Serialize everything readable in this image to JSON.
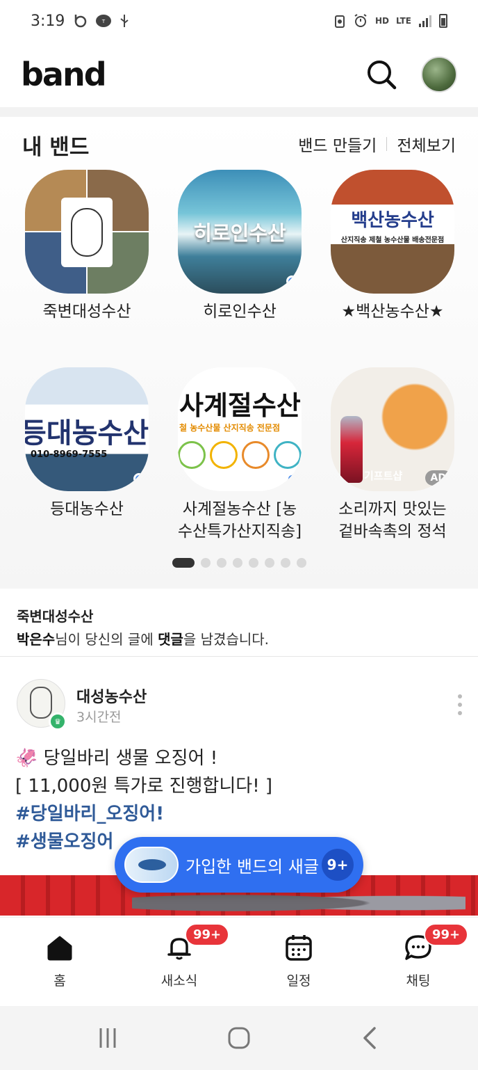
{
  "status_bar": {
    "time": "3:19",
    "left_icons": [
      "b-app-icon",
      "tmap-icon",
      "usb-icon"
    ],
    "right_icons": [
      "data-saver-icon",
      "alarm-icon",
      "hd-voice-icon",
      "lte-icon",
      "signal-icon",
      "battery-icon"
    ],
    "hd_label": "HD",
    "lte_label": "LTE"
  },
  "header": {
    "logo": "band",
    "search_icon": "search-icon",
    "avatar_icon": "profile-avatar"
  },
  "my_bands": {
    "title": "내 밴드",
    "create_label": "밴드 만들기",
    "view_all_label": "전체보기",
    "bands": [
      {
        "name": "죽변대성수산",
        "has_new": false
      },
      {
        "name": "히로인수산",
        "thumb_text": "히로인수산",
        "has_new": true
      },
      {
        "name": "★백산농수산★",
        "thumb_text": "백산농수산",
        "thumb_subtext": "산지직송 제철 농수산물 배송전문점",
        "has_new": false
      },
      {
        "name": "등대농수산",
        "thumb_text": "등대농수산",
        "thumb_subtext": "010-8969-7555",
        "has_new": true
      },
      {
        "name": "사계절농수산 [농수산특가산지직송]",
        "name_line1": "사계절농수산 [농",
        "name_line2": "수산특가산지직송]",
        "thumb_text": "사계절수산",
        "thumb_subtext": "철 농수산물 산지직송 전문점",
        "has_new": true
      },
      {
        "name": "소리까지 맛있는 겉바속촉의 정석",
        "name_line1": "소리까지 맛있는",
        "name_line2": "겉바속촉의 정석",
        "thumb_text": "기프트샵",
        "ad_label": "AD",
        "is_ad": true
      }
    ],
    "pager": {
      "total": 8,
      "current": 1
    }
  },
  "notification": {
    "band": "죽변대성수산",
    "user": "박은수",
    "text_mid": "님이 당신의 글에 ",
    "keyword": "댓글",
    "text_end": "을 남겼습니다."
  },
  "post": {
    "author": "대성농수산",
    "time": "3시간전",
    "line1": "🦑 당일바리 생물 오징어 !",
    "line2": "[ 11,000원 특가로 진행합니다! ]",
    "hashtag1": "#당일바리_오징어!",
    "hashtag2": "#생물오징어"
  },
  "new_posts_pill": {
    "label": "가입한 밴드의 새글",
    "count": "9+"
  },
  "bottom_nav": [
    {
      "label": "홈",
      "icon": "home-icon",
      "active": true
    },
    {
      "label": "새소식",
      "icon": "bell-icon",
      "badge": "99+"
    },
    {
      "label": "일정",
      "icon": "calendar-icon"
    },
    {
      "label": "채팅",
      "icon": "chat-icon",
      "badge": "99+"
    }
  ],
  "colors": {
    "accent": "#2f6ff0",
    "badge": "#e8343a",
    "hashtag": "#2f5a98",
    "new_dot": "#4a8be8"
  }
}
